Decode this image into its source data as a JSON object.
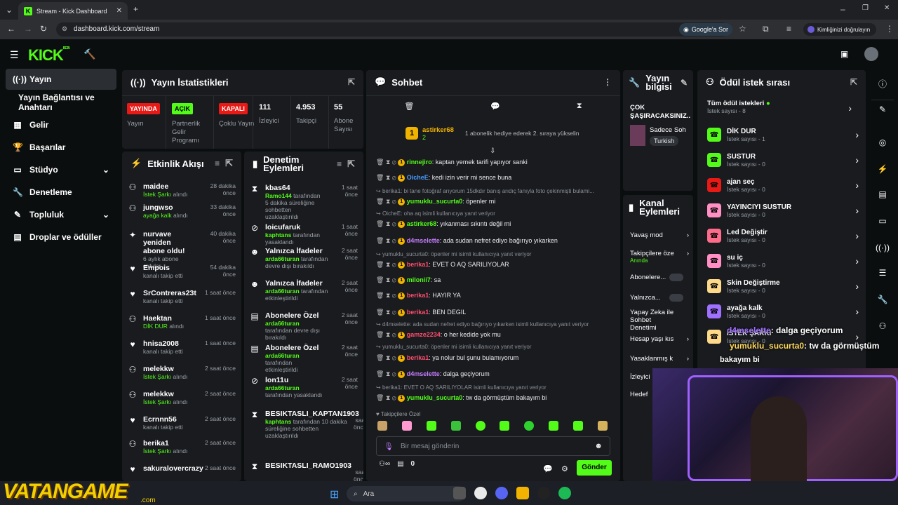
{
  "browser": {
    "tab_title": "Stream - Kick Dashboard",
    "url": "dashboard.kick.com/stream",
    "google_label": "Google'a Sor",
    "profile_label": "Kimliğinizi doğrulayın"
  },
  "brand": {
    "logo": "KICK",
    "beta": "BETA"
  },
  "sidebar": {
    "items": [
      {
        "label": "Yayın",
        "icon": "broadcast-icon"
      },
      {
        "label": "Yayın Bağlantısı ve Anahtarı",
        "icon": ""
      },
      {
        "label": "Gelir",
        "icon": "chart-icon"
      },
      {
        "label": "Başarılar",
        "icon": "trophy-icon"
      },
      {
        "label": "Stüdyo",
        "icon": "studio-icon"
      },
      {
        "label": "Denetleme",
        "icon": "wrench-icon"
      },
      {
        "label": "Topluluk",
        "icon": "community-icon"
      },
      {
        "label": "Droplar ve ödüller",
        "icon": "gift-icon"
      }
    ]
  },
  "stats": {
    "title": "Yayın İstatistikleri",
    "cols": [
      {
        "badge": "YAYINDA",
        "badge_color": "#e91916",
        "label": "Yayın"
      },
      {
        "badge": "AÇIK",
        "badge_color": "#53fc18",
        "label": "Partnerlik Gelir Programı"
      },
      {
        "badge": "KAPALI",
        "badge_color": "#e91916",
        "label": "Çoklu Yayın"
      },
      {
        "value": "111",
        "label": "İzleyici"
      },
      {
        "value": "4.953",
        "label": "Takipçi"
      },
      {
        "value": "55",
        "label": "Abone Sayısı"
      }
    ]
  },
  "activity": {
    "title": "Etkinlik Akışı",
    "items": [
      {
        "name": "maidee",
        "sub": "İstek Şarkı",
        "sub2": " alındı",
        "time": "28 dakika önce",
        "icon": "reward-icon"
      },
      {
        "name": "jungwso",
        "sub": "ayağa kalk",
        "sub2": " alındı",
        "time": "33 dakika önce",
        "icon": "reward-icon"
      },
      {
        "name": "nurvave yeniden abone oldu!",
        "sub": "6 aylık abone oldular",
        "sub2": "",
        "time": "40 dakika önce",
        "icon": "star-icon"
      },
      {
        "name": "Empois",
        "sub": "kanalı takip etti",
        "sub2": "",
        "time": "54 dakika önce",
        "icon": "heart-icon"
      },
      {
        "name": "SrContreras23t",
        "sub": "kanalı takip etti",
        "sub2": "",
        "time": "1 saat önce",
        "icon": "heart-icon"
      },
      {
        "name": "Haektan",
        "sub": "DİK DUR",
        "sub2": " alındı",
        "time": "1 saat önce",
        "icon": "reward-icon"
      },
      {
        "name": "hnisa2008",
        "sub": "kanalı takip etti",
        "sub2": "",
        "time": "1 saat önce",
        "icon": "heart-icon"
      },
      {
        "name": "melekkw",
        "sub": "İstek Şarkı",
        "sub2": " alındı",
        "time": "2 saat önce",
        "icon": "reward-icon"
      },
      {
        "name": "melekkw",
        "sub": "İstek Şarkı",
        "sub2": " alındı",
        "time": "2 saat önce",
        "icon": "reward-icon"
      },
      {
        "name": "Ecrnnn56",
        "sub": "kanalı takip etti",
        "sub2": "",
        "time": "2 saat önce",
        "icon": "heart-icon"
      },
      {
        "name": "berika1",
        "sub": "İstek Şarkı",
        "sub2": " alındı",
        "time": "2 saat önce",
        "icon": "reward-icon"
      },
      {
        "name": "sakuralovercrazy",
        "sub": "",
        "sub2": "",
        "time": "2 saat önce",
        "icon": "heart-icon"
      }
    ]
  },
  "moderation": {
    "title": "Denetim Eylemleri",
    "items": [
      {
        "name": "kbas64",
        "who": "Ramo144",
        "txt": " tarafından 5 dakika süreliğine sohbetten uzaklaştırıldı",
        "time": "1 saat önce",
        "icon": "hourglass-icon"
      },
      {
        "name": "loicufaruk",
        "who": "kaphtans",
        "txt": " tarafından yasaklandı",
        "time": "1 saat önce",
        "icon": "ban-icon"
      },
      {
        "name": "Yalnızca İfadeler",
        "who": "arda66turan",
        "txt": " tarafından devre dışı bırakıldı",
        "time": "2 saat önce",
        "icon": "emote-icon"
      },
      {
        "name": "Yalnızca İfadeler",
        "who": "arda66turan",
        "txt": " tarafından etkinleştirildi",
        "time": "2 saat önce",
        "icon": "emote-icon"
      },
      {
        "name": "Abonelere Özel",
        "who": "arda66turan",
        "txt": " tarafından devre dışı bırakıldı",
        "time": "2 saat önce",
        "icon": "gift-icon"
      },
      {
        "name": "Abonelere Özel",
        "who": "arda66turan",
        "txt": " tarafından etkinleştirildi",
        "time": "2 saat önce",
        "icon": "gift-icon"
      },
      {
        "name": "lon11u",
        "who": "arda66turan",
        "txt": " tarafından yasaklandı",
        "time": "2 saat önce",
        "icon": "ban-icon"
      },
      {
        "name": "BESIKTASLI_KAPTAN1903",
        "who": "kaphtans",
        "txt": " tarafından 10 dakika süreliğine sohbetten uzaklaştırıldı",
        "time": "3 saat önce",
        "icon": "hourglass-icon"
      },
      {
        "name": "BESIKTASLI_RAMO1903",
        "who": "",
        "txt": "",
        "time": "3 saat önce",
        "icon": "hourglass-icon"
      }
    ]
  },
  "chat": {
    "title": "Sohbet",
    "pinned_user": "astirker68",
    "pinned_count": "2",
    "pinned_text": "1 abonelik hediye ederek 2. sıraya yükselin",
    "messages": [
      {
        "type": "msg",
        "user": "rinnejiro",
        "color": "#53fc18",
        "text": ": kaptan yemek tarifi yapıyor sanki"
      },
      {
        "type": "msg",
        "user": "OicheE",
        "color": "#4a9cff",
        "text": ": kedi izin verir mi sence buna"
      },
      {
        "type": "reply",
        "text": "berika1: bi tane fotoğraf arıyorum 15dkdır banış arıdıç fanıyla foto çekinmişti bulami..."
      },
      {
        "type": "msg",
        "user": "yumuklu_sucurta0",
        "color": "#53fc18",
        "text": ": öpenler mi"
      },
      {
        "type": "reply",
        "text": "OicheE: oha aq isimli kullanıcıya yanıt veriyor"
      },
      {
        "type": "msg",
        "user": "astirker68",
        "color": "#53fc18",
        "text": ": yıkanması sıkıntı değil mi"
      },
      {
        "type": "msg",
        "user": "d4mselette",
        "color": "#c77dff",
        "text": ": ada sudan nefret ediyo bağırıyo yıkarken"
      },
      {
        "type": "reply",
        "text": "yumuklu_sucurta0: öpenler mi isimli kullanıcıya yanıt veriyor"
      },
      {
        "type": "msg",
        "user": "berika1",
        "color": "#ff4d6d",
        "text": ": EVET O AQ SARILIYOLAR"
      },
      {
        "type": "msg",
        "user": "milonii7",
        "color": "#53fc18",
        "text": ": sa"
      },
      {
        "type": "msg",
        "user": "berika1",
        "color": "#ff4d6d",
        "text": ": HAYIR YA"
      },
      {
        "type": "msg",
        "user": "berika1",
        "color": "#ff4d6d",
        "text": ": BEN DEGIL"
      },
      {
        "type": "reply",
        "text": "d4mselette: ada sudan nefret ediyo bağırıyo yıkarken isimli kullanıcıya yanıt veriyor"
      },
      {
        "type": "msg",
        "user": "gamze2234",
        "color": "#ff4d6d",
        "text": ": o her kedide yok mu"
      },
      {
        "type": "reply",
        "text": "yumuklu_sucurta0: öpenler mi isimli kullanıcıya yanıt veriyor"
      },
      {
        "type": "msg",
        "user": "berika1",
        "color": "#ff4d6d",
        "text": ": ya nolur bul şunu bulamıyorum"
      },
      {
        "type": "msg",
        "user": "d4mselette",
        "color": "#c77dff",
        "text": ": dalga geçiyorum"
      },
      {
        "type": "reply",
        "text": "berika1: EVET O AQ SARILIYOLAR isimli kullanıcıya yanıt veriyor"
      },
      {
        "type": "msg",
        "user": "yumuklu_sucurta0",
        "color": "#53fc18",
        "text": ": tw da görmüştüm bakayım bi"
      }
    ],
    "followers_only": "Takipçilere Özel",
    "input_placeholder": "Bir mesaj gönderin",
    "points": "0",
    "send": "Gönder"
  },
  "streaminfo": {
    "title": "Yayın bilgisi",
    "stream_title": "ÇOK ŞAŞIRACAKSINIZ..",
    "category": "Sadece Soh",
    "tag": "Turkish"
  },
  "channel_actions": {
    "title": "Kanal Eylemleri",
    "items": [
      "Yavaş mod",
      "Takipçilere öze",
      "Abonelere...",
      "Yalnızca...",
      "Yapay Zeka ile Sohbet Denetimi",
      "Hesap yaşı kıs",
      "Yasaklanmış k",
      "İzleyici",
      "Hedef"
    ],
    "followers_sub": "Anında"
  },
  "rewards": {
    "title": "Ödül istek sırası",
    "all": "Tüm ödül istekleri",
    "all_count": "İstek sayısı - 8",
    "items": [
      {
        "name": "DİK DUR",
        "count": "İstek sayısı - 1",
        "color": "#53fc18"
      },
      {
        "name": "SUSTUR",
        "count": "İstek sayısı - 0",
        "color": "#53fc18"
      },
      {
        "name": "ajan seç",
        "count": "İstek sayısı - 0",
        "color": "#e91916"
      },
      {
        "name": "YAYINCIYI SUSTUR",
        "count": "İstek sayısı - 0",
        "color": "#ff8fc4"
      },
      {
        "name": "Led Değiştir",
        "count": "İstek sayısı - 0",
        "color": "#ff6b8a"
      },
      {
        "name": "su iç",
        "count": "İstek sayısı - 0",
        "color": "#ff8fc4"
      },
      {
        "name": "Skin Değiştirme",
        "count": "İstek sayısı - 0",
        "color": "#ffd98a"
      },
      {
        "name": "ayağa kalk",
        "count": "İstek sayısı - 0",
        "color": "#a070ff"
      },
      {
        "name": "İSTEK ŞARKI",
        "count": "İstek sayısı - 0",
        "color": "#ffd98a"
      }
    ]
  },
  "overlay": {
    "line1_user": "d4mselette",
    "line1_text": ": dalga geçiyorum",
    "line2_user": "yumuklu_sucurta0",
    "line2_text": ": tw da görmüştüm",
    "line3": "bakayım bi",
    "watermark": "VATANGAME",
    "watermark_sub": ".com"
  },
  "taskbar": {
    "search": "Ara"
  }
}
